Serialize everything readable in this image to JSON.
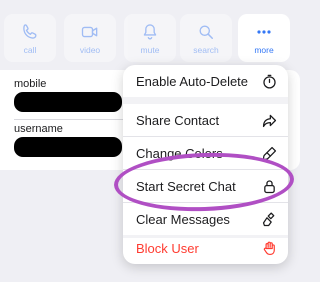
{
  "actions": {
    "call": "call",
    "video": "video",
    "mute": "mute",
    "search": "search",
    "more": "more"
  },
  "info": {
    "mobile_label": "mobile",
    "username_label": "username"
  },
  "menu": {
    "items": [
      {
        "label": "Enable Auto-Delete",
        "icon": "timer-icon"
      },
      {
        "label": "Share Contact",
        "icon": "share-arrow-icon"
      },
      {
        "label": "Change Colors",
        "icon": "brush-icon"
      },
      {
        "label": "Start Secret Chat",
        "icon": "lock-icon"
      },
      {
        "label": "Clear Messages",
        "icon": "clear-brush-icon"
      },
      {
        "label": "Block User",
        "icon": "stop-hand-icon"
      }
    ]
  },
  "colors": {
    "accent": "#3478f6",
    "danger": "#ff3b30",
    "highlight": "#b04fc4",
    "background": "#efeff4"
  }
}
